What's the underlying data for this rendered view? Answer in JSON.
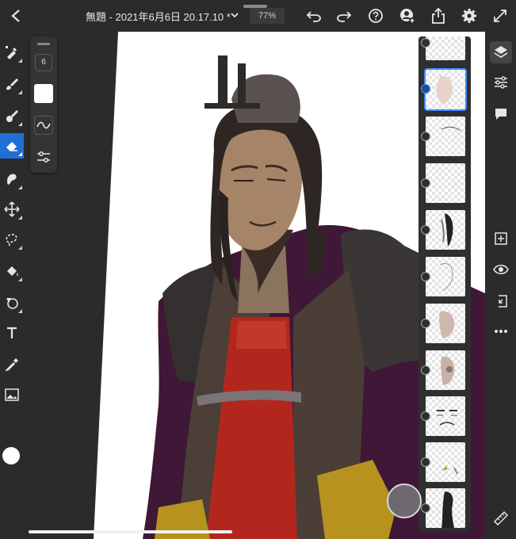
{
  "header": {
    "document_title": "無題 - 2021年6月6日 20.17.10 *",
    "zoom": "77%"
  },
  "toolbar_icons": [
    "back-icon",
    "undo-icon",
    "redo-icon",
    "help-icon",
    "share-user-icon",
    "export-icon",
    "settings-icon",
    "fullscreen-icon"
  ],
  "left_tools": [
    "pixel-brush-icon",
    "paint-brush-icon",
    "mixer-brush-icon",
    "eraser-icon",
    "smudge-icon",
    "move-icon",
    "lasso-icon",
    "fill-icon",
    "shape-icon",
    "text-icon",
    "eyedropper-icon",
    "image-icon"
  ],
  "active_tool": "eraser",
  "current_color": "#ffffff",
  "brush_panel": {
    "size": "6",
    "brush_color": "#ffffff"
  },
  "layers": {
    "count": 11,
    "selected_index": 1
  },
  "right_icons": [
    "layers-icon",
    "adjustments-icon",
    "comments-icon",
    "add-layer-icon",
    "visibility-icon",
    "import-icon",
    "more-icon"
  ],
  "colors": {
    "accent": "#1f6fd6",
    "ui_bg": "#2b2b2b",
    "robe_red": "#b3261e",
    "robe_purple": "#3e1836",
    "gold": "#b8921e"
  }
}
